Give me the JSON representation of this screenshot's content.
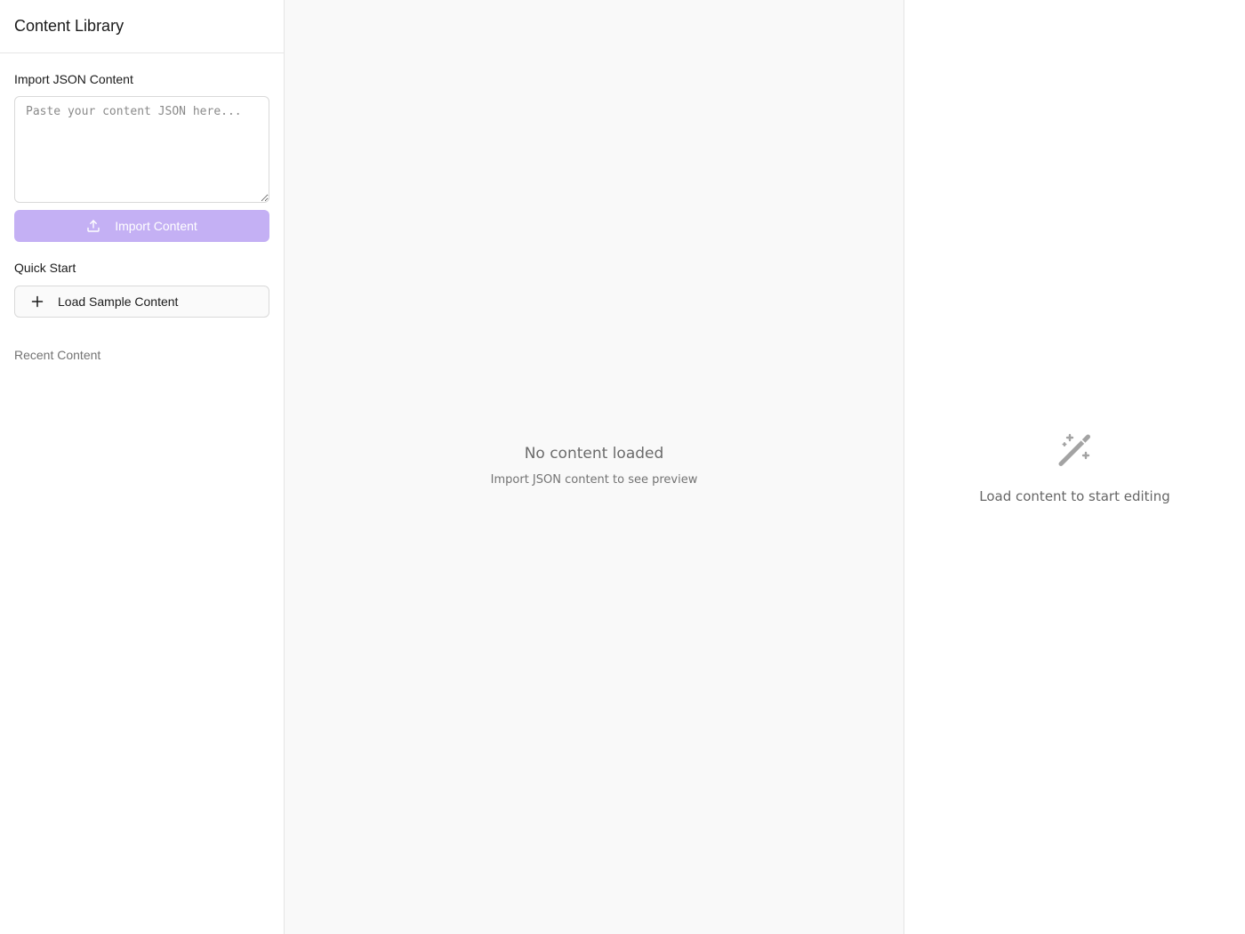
{
  "sidebar": {
    "title": "Content Library",
    "import": {
      "label": "Import JSON Content",
      "placeholder": "Paste your content JSON here...",
      "value": "",
      "button_label": "Import Content",
      "button_icon": "upload-icon"
    },
    "quick_start": {
      "label": "Quick Start",
      "sample_button_label": "Load Sample Content",
      "sample_button_icon": "plus-icon"
    },
    "recent": {
      "label": "Recent Content",
      "items": []
    }
  },
  "preview": {
    "empty_title": "No content loaded",
    "empty_subtitle": "Import JSON content to see preview"
  },
  "editor": {
    "empty_icon": "magic-wand-icon",
    "empty_text": "Load content to start editing"
  },
  "colors": {
    "accent_disabled": "#c4b0f4",
    "border": "#e5e5e5",
    "preview_bg": "#f9f9f9",
    "muted_text": "#737373"
  }
}
